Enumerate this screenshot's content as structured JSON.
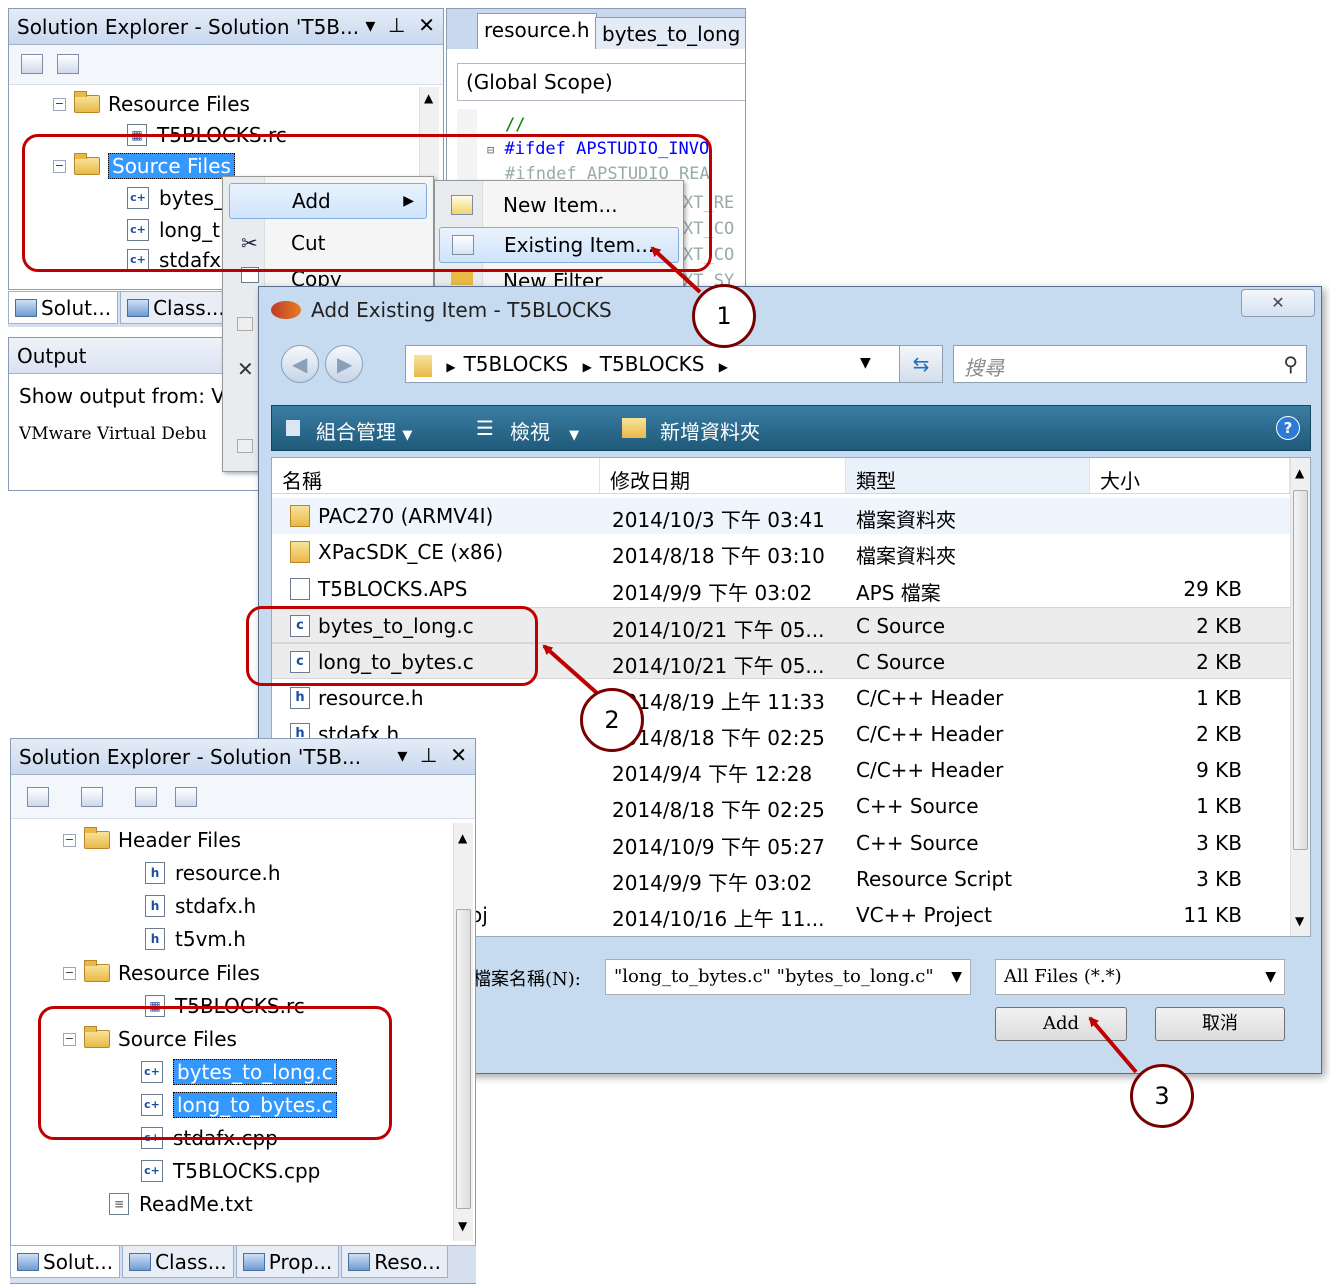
{
  "top_solution_explorer": {
    "title": "Solution Explorer - Solution 'T5B...",
    "tree": [
      {
        "label": "Resource Files",
        "kind": "folder"
      },
      {
        "label": "T5BLOCKS.rc",
        "kind": "rc"
      },
      {
        "label": "Source Files",
        "kind": "folder"
      },
      {
        "label": "bytes_",
        "kind": "cpp"
      },
      {
        "label": "long_t",
        "kind": "cpp"
      },
      {
        "label": "stdafx",
        "kind": "cpp"
      }
    ],
    "tabs": [
      "Solut...",
      "Class..."
    ]
  },
  "output_panel": {
    "title": "Output",
    "show_from_label": "Show output from:",
    "show_from_value": "V",
    "text": "VMware Virtual Debu"
  },
  "editor": {
    "tabs": [
      "resource.h",
      "bytes_to_long"
    ],
    "scope": "(Global Scope)",
    "code_lines": [
      "//",
      "#ifdef APSTUDIO_INVO",
      "#ifndef APSTUDIO_REA"
    ],
    "right_fragments": [
      "XT_RE",
      "XT_CO",
      "XT_CO",
      "XT_SY"
    ]
  },
  "context_menu": {
    "items": [
      "Add",
      "Cut",
      "Copy"
    ]
  },
  "add_submenu": {
    "items": [
      "New Item...",
      "Existing Item...",
      "New Filter"
    ]
  },
  "dialog": {
    "title": "Add Existing Item - T5BLOCKS",
    "breadcrumb": [
      "T5BLOCKS",
      "T5BLOCKS"
    ],
    "search_placeholder": "搜尋",
    "commands": [
      "組合管理",
      "檢視",
      "新增資料夾"
    ],
    "columns": [
      "名稱",
      "修改日期",
      "類型",
      "大小"
    ],
    "files": [
      {
        "name": "PAC270 (ARMV4I)",
        "date": "2014/10/3 下午 03:41",
        "type": "檔案資料夾",
        "size": "",
        "icon": "folder"
      },
      {
        "name": "XPacSDK_CE (x86)",
        "date": "2014/8/18 下午 03:10",
        "type": "檔案資料夾",
        "size": "",
        "icon": "folder"
      },
      {
        "name": "T5BLOCKS.APS",
        "date": "2014/9/9 下午 03:02",
        "type": "APS 檔案",
        "size": "29 KB",
        "icon": "file"
      },
      {
        "name": "bytes_to_long.c",
        "date": "2014/10/21 下午 05...",
        "type": "C Source",
        "size": "2 KB",
        "icon": "c"
      },
      {
        "name": "long_to_bytes.c",
        "date": "2014/10/21 下午 05...",
        "type": "C Source",
        "size": "2 KB",
        "icon": "c"
      },
      {
        "name": "resource.h",
        "date": "2014/8/19 上午 11:33",
        "type": "C/C++ Header",
        "size": "1 KB",
        "icon": "h"
      },
      {
        "name": "stdafx.h",
        "date": "2014/8/18 下午 02:25",
        "type": "C/C++ Header",
        "size": "2 KB",
        "icon": "h"
      },
      {
        "name": "",
        "date": "2014/9/4 下午 12:28",
        "type": "C/C++ Header",
        "size": "9 KB",
        "icon": ""
      },
      {
        "name": "",
        "date": "2014/8/18 下午 02:25",
        "type": "C++ Source",
        "size": "1 KB",
        "icon": ""
      },
      {
        "name": "",
        "date": "2014/10/9 下午 05:27",
        "type": "C++ Source",
        "size": "3 KB",
        "icon": ""
      },
      {
        "name": "",
        "date": "2014/9/9 下午 03:02",
        "type": "Resource Script",
        "size": "3 KB",
        "icon": ""
      },
      {
        "name": "oj",
        "date": "2014/10/16 上午 11...",
        "type": "VC++ Project",
        "size": "11 KB",
        "icon": ""
      }
    ],
    "filename_label": "檔案名稱(N):",
    "filename_value": "\"long_to_bytes.c\" \"bytes_to_long.c\"",
    "filter_value": "All Files (*.*)",
    "add_label": "Add",
    "cancel_label": "取消"
  },
  "bottom_solution_explorer": {
    "title": "Solution Explorer - Solution 'T5B...",
    "tree": [
      {
        "label": "Header Files",
        "kind": "folder"
      },
      {
        "label": "resource.h",
        "kind": "h"
      },
      {
        "label": "stdafx.h",
        "kind": "h"
      },
      {
        "label": "t5vm.h",
        "kind": "h"
      },
      {
        "label": "Resource Files",
        "kind": "folder"
      },
      {
        "label": "T5BLOCKS.rc",
        "kind": "rc"
      },
      {
        "label": "Source Files",
        "kind": "folder"
      },
      {
        "label": "bytes_to_long.c",
        "kind": "cpp"
      },
      {
        "label": "long_to_bytes.c",
        "kind": "cpp"
      },
      {
        "label": "stdafx.cpp",
        "kind": "cpp"
      },
      {
        "label": "T5BLOCKS.cpp",
        "kind": "cpp"
      },
      {
        "label": "ReadMe.txt",
        "kind": "txt"
      }
    ],
    "tabs": [
      "Solut...",
      "Class...",
      "Prop...",
      "Reso..."
    ]
  },
  "callouts": [
    "1",
    "2",
    "3"
  ],
  "colors": {
    "annotation_red": "#c00000",
    "selection_blue": "#3399ff",
    "dialog_bar": "#1f5a7a"
  }
}
